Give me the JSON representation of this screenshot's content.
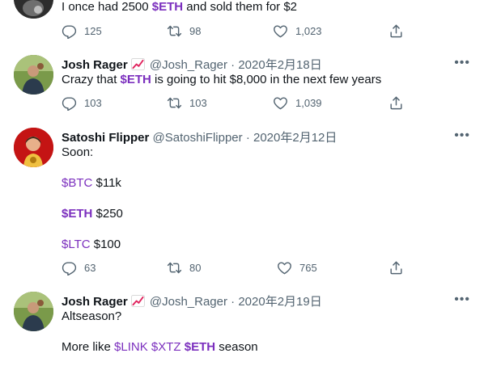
{
  "tweets": [
    {
      "text_before": "I once had 2500 ",
      "cashtag": "$ETH",
      "text_after": " and sold them for $2",
      "replies": "125",
      "retweets": "98",
      "likes": "1,023"
    },
    {
      "name": "Josh Rager",
      "handle": "@Josh_Rager",
      "separator": "·",
      "date": "2020年2月18日",
      "text_before": "Crazy that ",
      "cashtag": "$ETH",
      "text_after": " is going to hit $8,000 in the next few years",
      "replies": "103",
      "retweets": "103",
      "likes": "1,039"
    },
    {
      "name": "Satoshi Flipper",
      "handle": "@SatoshiFlipper",
      "separator": "·",
      "date": "2020年2月12日",
      "line1": "Soon:",
      "btc_tag": "$BTC",
      "btc_val": " $11k",
      "eth_tag": "$ETH",
      "eth_val": " $250",
      "ltc_tag": "$LTC",
      "ltc_val": " $100",
      "replies": "63",
      "retweets": "80",
      "likes": "765"
    },
    {
      "name": "Josh Rager",
      "handle": "@Josh_Rager",
      "separator": "·",
      "date": "2020年2月19日",
      "line1": "Altseason?",
      "line2_before": "More like ",
      "tag1": "$LINK",
      "tag2": "$XTZ",
      "tag3": "$ETH",
      "line2_after": " season"
    }
  ],
  "more_label": "•••",
  "colors": {
    "cashtag": "#7b2fbe",
    "muted": "#536471",
    "divider": "#e6ecf0"
  },
  "icons": [
    "reply-icon",
    "retweet-icon",
    "like-icon",
    "share-icon",
    "more-icon",
    "chart-increasing-icon"
  ]
}
